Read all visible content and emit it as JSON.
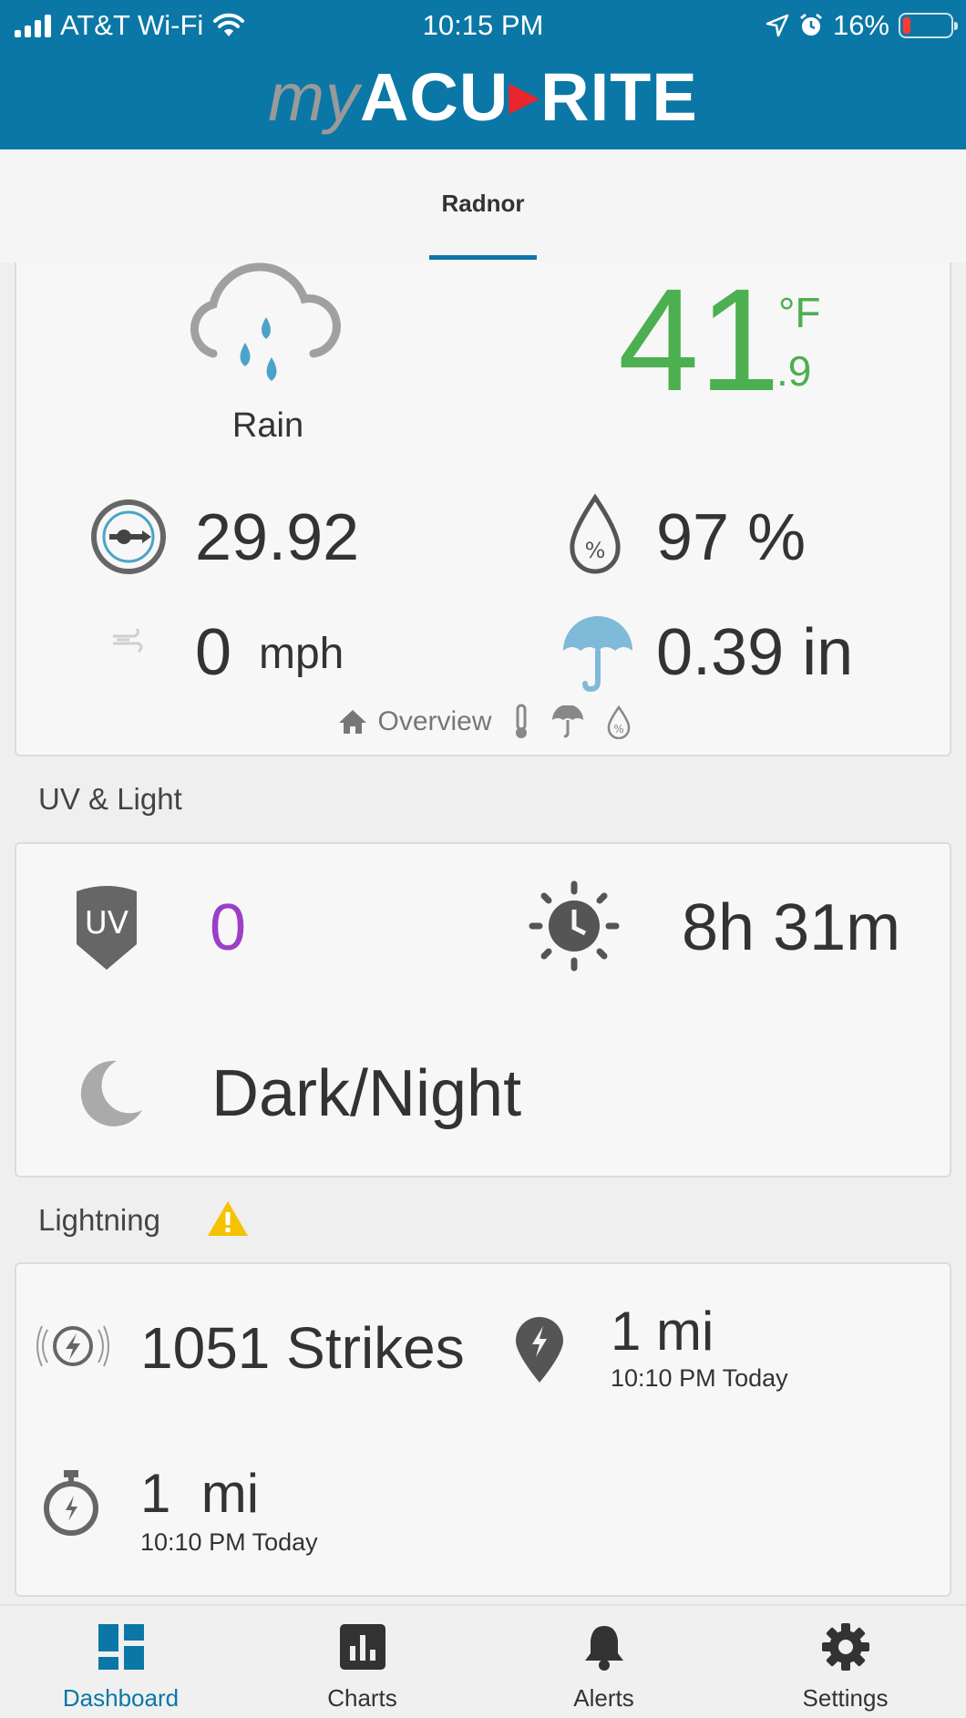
{
  "status_bar": {
    "carrier": "AT&T Wi-Fi",
    "time": "10:15 PM",
    "battery": "16%"
  },
  "header": {
    "logo_my": "my",
    "logo_brand_left": "ACU",
    "logo_brand_right": "RITE"
  },
  "location_tab": {
    "label": "Radnor"
  },
  "weather": {
    "condition": "Rain",
    "temperature_int": "41",
    "temperature_unit": "°F",
    "temperature_dec": ".9",
    "pressure": "29.92",
    "humidity": "97 %",
    "wind_value": "0",
    "wind_unit": "mph",
    "rainfall": "0.39 in",
    "overview_label": "Overview"
  },
  "uv_light": {
    "section_title": "UV & Light",
    "uv_badge": "UV",
    "uv_index": "0",
    "daylight": "8h 31m",
    "light_condition": "Dark/Night"
  },
  "lightning": {
    "section_title": "Lightning",
    "strikes": "1051 Strikes",
    "closest_distance": "1 mi",
    "closest_time": "10:10 PM Today",
    "last_distance": "1  mi",
    "last_time": "10:10 PM Today"
  },
  "bottom_nav": {
    "items": [
      {
        "label": "Dashboard",
        "icon": "dashboard-icon"
      },
      {
        "label": "Charts",
        "icon": "charts-icon"
      },
      {
        "label": "Alerts",
        "icon": "bell-icon"
      },
      {
        "label": "Settings",
        "icon": "gear-icon"
      }
    ]
  },
  "colors": {
    "brand_blue": "#0b77a6",
    "temperature_green": "#4caf50",
    "uv_purple": "#9b3fc8",
    "rain_blue": "#4ca3c9",
    "warning_yellow": "#f5c200"
  }
}
